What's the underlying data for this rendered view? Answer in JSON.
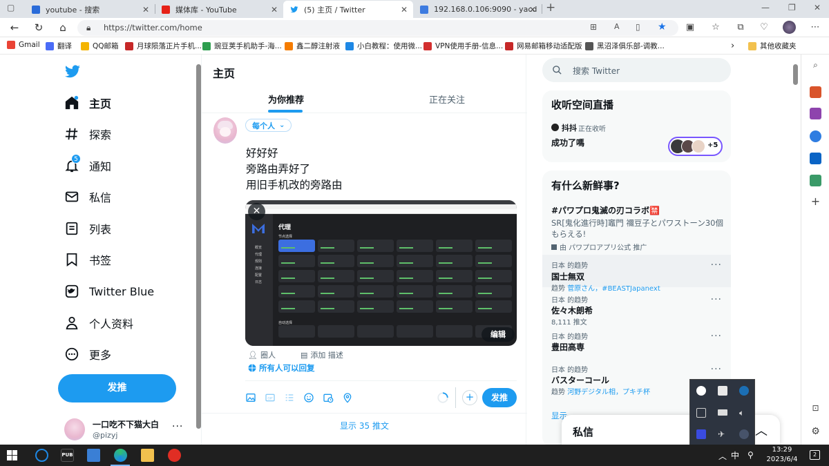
{
  "browser": {
    "tabs": [
      {
        "title": "youtube - 搜索",
        "color": "#2b6cd9"
      },
      {
        "title": "媒体库 - YouTube",
        "color": "#e62117"
      },
      {
        "title": "(5) 主页 / Twitter",
        "color": "#1d9bf0"
      },
      {
        "title": "192.168.0.106:9090 - yacd",
        "color": "#3d7be0"
      }
    ],
    "url": "https://twitter.com/home",
    "bookmarks": [
      {
        "label": "Gmail",
        "color": "#ea4335"
      },
      {
        "label": "翻译",
        "color": "#4a6cf7"
      },
      {
        "label": "QQ邮箱",
        "color": "#f4b400"
      },
      {
        "label": "月球陨落正片手机...",
        "color": "#c62828"
      },
      {
        "label": "豌豆荚手机助手-海...",
        "color": "#2e9e4f"
      },
      {
        "label": "鑫二醇注射液",
        "color": "#f57c00"
      },
      {
        "label": "小白教程：使用微...",
        "color": "#1e88e5"
      },
      {
        "label": "VPN使用手册-信息...",
        "color": "#d32f2f"
      },
      {
        "label": "网易邮箱移动适配版",
        "color": "#c62828"
      },
      {
        "label": "黑沼泽俱乐部-调教...",
        "color": "#555555"
      }
    ],
    "other_bookmarks": "其他收藏夹"
  },
  "nav": {
    "home": "主页",
    "explore": "探索",
    "notifications": "通知",
    "notifications_badge": "5",
    "messages": "私信",
    "lists": "列表",
    "bookmarks": "书签",
    "blue": "Twitter Blue",
    "profile": "个人资料",
    "more": "更多",
    "post_button": "发推",
    "user_name": "一口吃不下猫大白",
    "user_handle": "@pizyj"
  },
  "main": {
    "title": "主页",
    "tab_for_you": "为你推荐",
    "tab_following": "正在关注",
    "audience": "每个人",
    "lines": [
      "好好好",
      "旁路由弄好了",
      "用旧手机改的旁路由"
    ],
    "image_edit": "编辑",
    "tag_people": "圈人",
    "add_desc": "添加 描述",
    "reply_setting": "所有人可以回复",
    "tweet_button": "发推",
    "show_more": "显示 35 推文",
    "shot": {
      "title": "代理",
      "section1": "节点选择",
      "section2": "自动选择",
      "menu": [
        "概览",
        "代理",
        "规则",
        "连接",
        "配置",
        "日志"
      ]
    }
  },
  "right": {
    "search_placeholder": "搜索 Twitter",
    "spaces_title": "收听空间直播",
    "spaces_host": "抖抖",
    "spaces_listening": "正在收听",
    "spaces_name": "成功了嗎",
    "spaces_count": "+5",
    "trends_title": "有什么新鲜事?",
    "promo": {
      "name": "#パワプロ鬼滅の刃コラボ🈲",
      "desc": "SR[鬼化進行時]竈門 禰豆子とパワストーン30個もらえる!",
      "by": "由 パワプロアプリ公式 推广"
    },
    "trends": [
      {
        "ctx": "日本 的趋势",
        "name": "国士無双",
        "sub_prefix": "趋势 ",
        "sub_link": "菅原さん，#BEASTJapanext"
      },
      {
        "ctx": "日本 的趋势",
        "name": "佐々木朗希",
        "sub_prefix": "8,111 推文",
        "sub_link": ""
      },
      {
        "ctx": "日本 的趋势",
        "name": "豊田高専",
        "sub_prefix": "",
        "sub_link": ""
      },
      {
        "ctx": "日本 的趋势",
        "name": "バスターコール",
        "sub_prefix": "趋势 ",
        "sub_link": "河野デジタル相，プキチ杯"
      }
    ],
    "show_more": "显示",
    "dm_title": "私信"
  },
  "taskbar": {
    "ime": "中",
    "time": "13:29",
    "date": "2023/6/4",
    "notif_count": "2"
  },
  "colors": {
    "accent": "#1d9bf0",
    "text": "#0f1419",
    "muted": "#536471"
  }
}
